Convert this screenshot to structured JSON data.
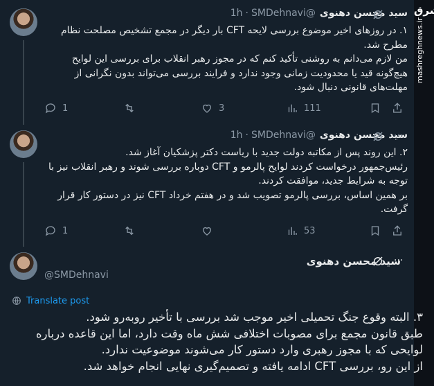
{
  "tweets": [
    {
      "name": "سید محسن دهنوی",
      "handle": "@SMDehnavi",
      "time": "1h",
      "text": "۱. در روزهای اخیر موضوع بررسی لایحه CFT بار دیگر در مجمع تشخیص مصلحت نظام مطرح شد.\nمن لازم می‌دانم به روشنی تأکید کنم که در مجوز رهبر انقلاب برای بررسی این لوایح هیچ‌گونه قید یا محدودیت زمانی وجود ندارد و فرایند بررسی می‌تواند بدون نگرانی از مهلت‌های قانونی دنبال شود.",
      "reply_count": "1",
      "retweet_count": "",
      "like_count": "3",
      "views_count": "111"
    },
    {
      "name": "سید محسن دهنوی",
      "handle": "@SMDehnavi",
      "time": "1h",
      "text": "۲. این روند پس از مکاتبه دولت جدید با ریاست دکتر پزشکیان آغاز شد.\nرئیس‌جمهور درخواست کردند لوایح پالرمو و CFT دوباره بررسی شوند و رهبر انقلاب نیز با توجه به شرایط جدید، موافقت کردند.\nبر همین اساس، بررسی پالرمو تصویب شد و در هفتم خرداد CFT نیز در دستور کار قرار گرفت.",
      "reply_count": "1",
      "retweet_count": "",
      "like_count": "",
      "views_count": "53"
    },
    {
      "name": "سید محسن دهنوی",
      "handle": "@SMDehnavi",
      "translate_label": "Translate post",
      "text": "۳. البته وقوع جنگ تحمیلی اخیر موجب شد بررسی با تأخیر روبه‌رو شود.\nطبق قانون مجمع برای مصوبات اختلافی شش ماه وقت دارد، اما این قاعده درباره لوایحی که با مجوز رهبری وارد دستور کار می‌شوند موضوعیت ندارد.\nاز این رو، بررسی CFT ادامه یافته و تصمیم‌گیری نهایی انجام خواهد شد."
    }
  ],
  "watermark": {
    "logo": "مشرق",
    "url": "mashreghnews.ir"
  },
  "colors": {
    "background": "#15202b",
    "text": "#e7e9ea",
    "muted": "#8b98a5",
    "accent": "#1d9bf0"
  }
}
